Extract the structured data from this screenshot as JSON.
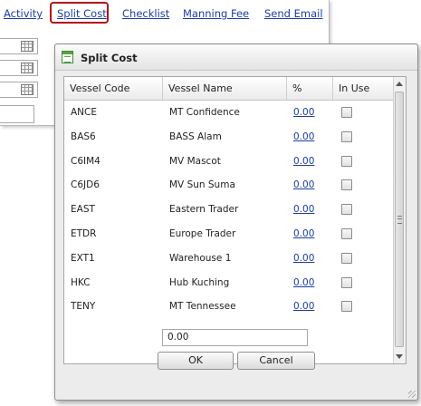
{
  "toplinks": [
    {
      "label": "Activity"
    },
    {
      "label": "Split Cost"
    },
    {
      "label": "Checklist"
    },
    {
      "label": "Manning Fee"
    },
    {
      "label": "Send Email"
    }
  ],
  "dialog": {
    "title": "Split Cost",
    "columns": [
      "Vessel Code",
      "Vessel Name",
      "%",
      "In Use"
    ],
    "rows": [
      {
        "code": "ANCE",
        "name": "MT Confidence",
        "pct": "0.00"
      },
      {
        "code": "BAS6",
        "name": "BASS Alam",
        "pct": "0.00"
      },
      {
        "code": "C6IM4",
        "name": "MV Mascot",
        "pct": "0.00"
      },
      {
        "code": "C6JD6",
        "name": "MV Sun Suma",
        "pct": "0.00"
      },
      {
        "code": "EAST",
        "name": "Eastern Trader",
        "pct": "0.00"
      },
      {
        "code": "ETDR",
        "name": "Europe Trader",
        "pct": "0.00"
      },
      {
        "code": "EXT1",
        "name": "Warehouse 1",
        "pct": "0.00"
      },
      {
        "code": "HKC",
        "name": "Hub Kuching",
        "pct": "0.00"
      },
      {
        "code": "TENY",
        "name": "MT Tennessee",
        "pct": "0.00"
      }
    ],
    "total": "0.00",
    "ok_label": "OK",
    "cancel_label": "Cancel"
  },
  "colors": {
    "link": "#1a3da8",
    "highlight_border": "#b5121b",
    "title_icon": "#54a83a"
  }
}
